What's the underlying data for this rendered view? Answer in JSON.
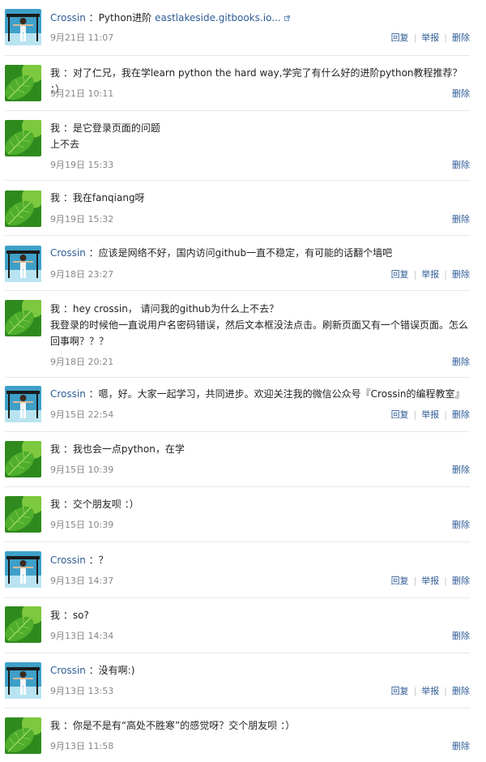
{
  "colors": {
    "link": "#2f5c96",
    "meta": "#888888",
    "separator": "#e8e8e8"
  },
  "icons": {
    "crossin": "crossin-avatar-icon",
    "me": "leaf-avatar-icon",
    "external": "external-link-icon"
  },
  "action_labels": {
    "reply": "回复",
    "report": "举报",
    "delete": "删除"
  },
  "messages": [
    {
      "author": "Crossin",
      "sep": " ：",
      "text": "Python进阶 ",
      "link": "eastlakeside.gitbooks.io...",
      "time": "9月21日 11:07"
    },
    {
      "author": "我",
      "sep": " ：",
      "text": "对了仁兄，我在学learn python the hard way,学完了有什么好的进阶python教程推荐？ ：）",
      "time": "9月21日 10:11"
    },
    {
      "author": "我",
      "sep": " ：",
      "text": "是它登录页面的问题",
      "text2": "上不去",
      "time": "9月19日 15:33"
    },
    {
      "author": "我",
      "sep": " ：",
      "text": "我在fanqiang呀",
      "time": "9月19日 15:32"
    },
    {
      "author": "Crossin",
      "sep": " ：",
      "text": "应该是网络不好，国内访问github一直不稳定，有可能的话翻个墙吧",
      "time": "9月18日 23:27"
    },
    {
      "author": "我",
      "sep": " ：",
      "text": "hey crossin， 请问我的github为什么上不去？",
      "text2": "我登录的时候他一直说用户名密码错误，然后文本框没法点击。刷新页面又有一个错误页面。怎么",
      "text3": "回事啊？？？",
      "time": "9月18日 20:21"
    },
    {
      "author": "Crossin",
      "sep": " ：",
      "text": "嗯，好。大家一起学习，共同进步。欢迎关注我的微信公众号『Crossin的编程教室』",
      "time": "9月15日 22:54"
    },
    {
      "author": "我",
      "sep": " ：",
      "text": "我也会一点python，在学",
      "time": "9月15日 10:39"
    },
    {
      "author": "我",
      "sep": " ：",
      "text": "交个朋友呗 ：）",
      "time": "9月15日 10:39"
    },
    {
      "author": "Crossin",
      "sep": " ：",
      "text": "？",
      "time": "9月13日 14:37"
    },
    {
      "author": "我",
      "sep": " ：",
      "text": "so?",
      "time": "9月13日 14:34"
    },
    {
      "author": "Crossin",
      "sep": " ：",
      "text": "没有啊:)",
      "time": "9月13日 13:53"
    },
    {
      "author": "我",
      "sep": " ：",
      "text": "你是不是有“高处不胜寒”的感觉呀？交个朋友呗 ：）",
      "time": "9月13日 11:58"
    }
  ]
}
